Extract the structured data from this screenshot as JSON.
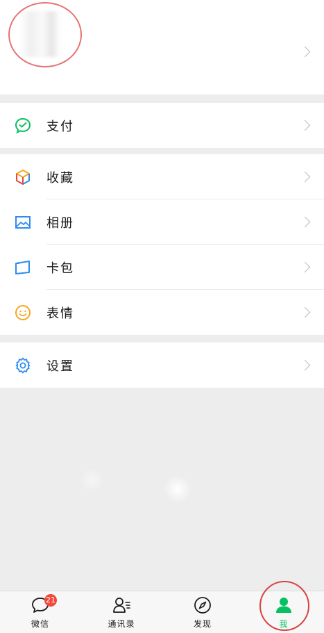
{
  "rows": {
    "pay": "支付",
    "favorites": "收藏",
    "album": "相册",
    "cards": "卡包",
    "stickers": "表情",
    "settings": "设置"
  },
  "tabs": {
    "chats": "微信",
    "contacts": "通讯录",
    "discover": "发现",
    "me": "我"
  },
  "badge": {
    "chats_unread": "21"
  },
  "colors": {
    "accent_green": "#07c160",
    "badge_red": "#f04a3b",
    "annotation_red": "#d84343",
    "icon_blue": "#2d8cf0",
    "icon_yellow": "#f5a623"
  }
}
